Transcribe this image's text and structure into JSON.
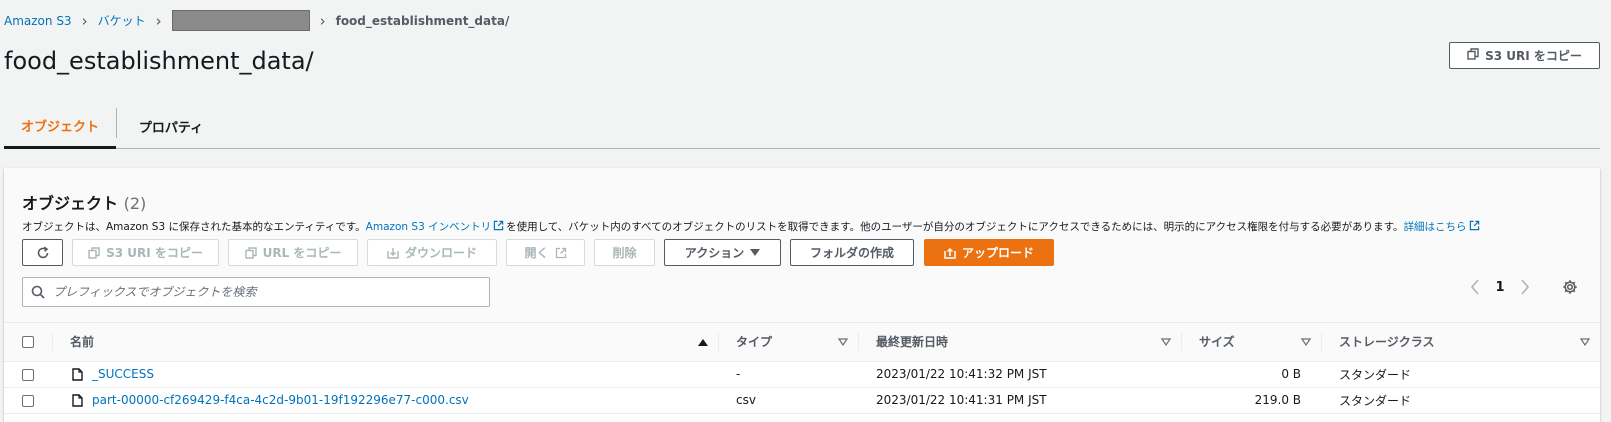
{
  "breadcrumb": {
    "items": [
      "Amazon S3",
      "バケット"
    ],
    "current": "food_establishment_data/"
  },
  "page": {
    "title": "food_establishment_data/",
    "copy_uri_label": "S3 URI をコピー"
  },
  "tabs": [
    {
      "label": "オブジェクト",
      "active": true
    },
    {
      "label": "プロパティ",
      "active": false
    }
  ],
  "objects": {
    "title": "オブジェクト",
    "count": "(2)",
    "desc_before": "オブジェクトは、Amazon S3 に保存された基本的なエンティティです。",
    "inventory_link": "Amazon S3 インベントリ",
    "desc_after": "を使用して、バケット内のすべてのオブジェクトのリストを取得できます。他のユーザーが自分のオブジェクトにアクセスできるためには、明示的にアクセス権限を付与する必要があります。",
    "learn_more": "詳細はこちら"
  },
  "toolbar": {
    "copy_s3_uri": "S3 URI をコピー",
    "copy_url": "URL をコピー",
    "download": "ダウンロード",
    "open": "開く",
    "delete": "削除",
    "actions": "アクション",
    "create_folder": "フォルダの作成",
    "upload": "アップロード"
  },
  "search": {
    "placeholder": "プレフィックスでオブジェクトを検索"
  },
  "pagination": {
    "page": "1"
  },
  "table": {
    "columns": {
      "name": "名前",
      "type": "タイプ",
      "modified": "最終更新日時",
      "size": "サイズ",
      "storage": "ストレージクラス"
    },
    "rows": [
      {
        "name": "_SUCCESS",
        "type": "-",
        "modified": "2023/01/22 10:41:32 PM JST",
        "size": "0 B",
        "storage": "スタンダード"
      },
      {
        "name": "part-00000-cf269429-f4ca-4c2d-9b01-19f192296e77-c000.csv",
        "type": "csv",
        "modified": "2023/01/22 10:41:31 PM JST",
        "size": "219.0 B",
        "storage": "スタンダード"
      }
    ]
  },
  "colors": {
    "accent": "#ec7211",
    "link": "#0073bb",
    "text": "#16191f"
  }
}
